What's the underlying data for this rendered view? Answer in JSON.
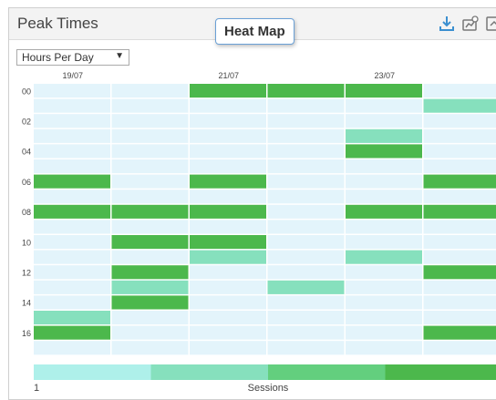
{
  "panel": {
    "title": "Peak Times",
    "tooltip": "Heat Map"
  },
  "toolbar": {
    "buttons": [
      {
        "icon": "download-icon"
      },
      {
        "icon": "chart-settings-icon"
      },
      {
        "icon": "expand-icon"
      }
    ]
  },
  "filter": {
    "selected": "Hours Per Day"
  },
  "colors": {
    "empty": "#e3f4fb",
    "level1": "#aef0ea",
    "level2": "#86e0bd",
    "level3": "#63cf7e",
    "level4": "#4cb84c"
  },
  "chart_data": {
    "type": "heatmap",
    "x_tick_labels": [
      "19/07",
      "21/07",
      "23/07"
    ],
    "y_tick_labels": [
      "00",
      "02",
      "04",
      "06",
      "08",
      "10",
      "12",
      "14",
      "16"
    ],
    "legend": {
      "min_label": "1",
      "label": "Sessions"
    },
    "rows": [
      [
        0,
        0,
        4,
        4,
        4,
        0
      ],
      [
        0,
        0,
        0,
        0,
        0,
        2
      ],
      [
        0,
        0,
        0,
        0,
        0,
        0
      ],
      [
        0,
        0,
        0,
        0,
        2,
        0
      ],
      [
        0,
        0,
        0,
        0,
        4,
        0
      ],
      [
        0,
        0,
        0,
        0,
        0,
        0
      ],
      [
        4,
        0,
        4,
        0,
        0,
        4
      ],
      [
        0,
        0,
        0,
        0,
        0,
        0
      ],
      [
        4,
        4,
        4,
        0,
        4,
        4
      ],
      [
        0,
        0,
        0,
        0,
        0,
        0
      ],
      [
        0,
        4,
        4,
        0,
        0,
        0
      ],
      [
        0,
        0,
        2,
        0,
        2,
        0
      ],
      [
        0,
        4,
        0,
        0,
        0,
        4
      ],
      [
        0,
        2,
        0,
        2,
        0,
        0
      ],
      [
        0,
        4,
        0,
        0,
        0,
        0
      ],
      [
        2,
        0,
        0,
        0,
        0,
        0
      ],
      [
        4,
        0,
        0,
        0,
        0,
        4
      ],
      [
        0,
        0,
        0,
        0,
        0,
        0
      ]
    ]
  }
}
